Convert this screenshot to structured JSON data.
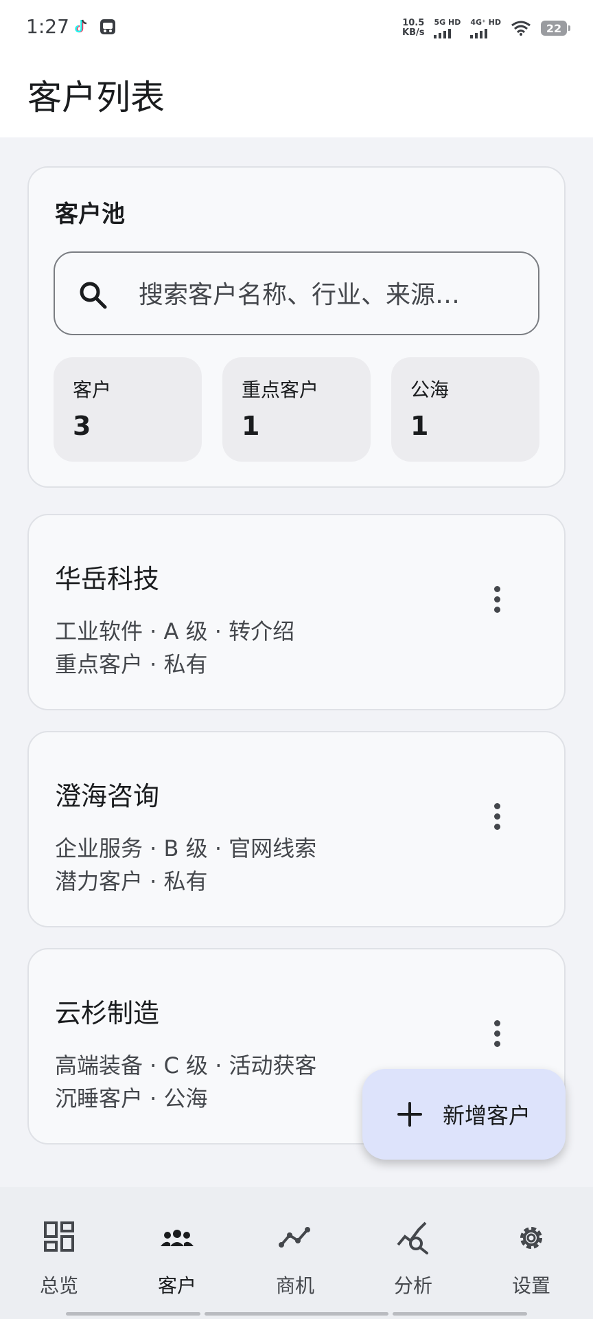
{
  "status_bar": {
    "time": "1:27",
    "net_speed": "10.5",
    "net_unit": "KB/s",
    "sim1": "5G HD",
    "sim2": "4G⁺ HD",
    "battery": "22",
    "icons": [
      "tiktok-icon",
      "app-notification-icon",
      "wifi-icon",
      "battery-icon"
    ]
  },
  "header": {
    "title": "客户列表"
  },
  "pool": {
    "title": "客户池",
    "search_placeholder": "搜索客户名称、行业、来源…",
    "stats": [
      {
        "label": "客户",
        "value": "3"
      },
      {
        "label": "重点客户",
        "value": "1"
      },
      {
        "label": "公海",
        "value": "1"
      }
    ]
  },
  "customers": [
    {
      "name": "华岳科技",
      "line1": "工业软件 · A 级 · 转介绍",
      "line2": "重点客户 · 私有"
    },
    {
      "name": "澄海咨询",
      "line1": "企业服务 · B 级 · 官网线索",
      "line2": "潜力客户 · 私有"
    },
    {
      "name": "云杉制造",
      "line1": "高端装备 · C 级 · 活动获客",
      "line2": "沉睡客户 · 公海"
    }
  ],
  "fab": {
    "label": "新增客户",
    "icon": "plus-icon"
  },
  "nav": {
    "active": "客户",
    "items": [
      {
        "label": "总览",
        "icon": "dashboard-icon"
      },
      {
        "label": "客户",
        "icon": "people-icon"
      },
      {
        "label": "商机",
        "icon": "trend-line-icon"
      },
      {
        "label": "分析",
        "icon": "analytics-search-icon"
      },
      {
        "label": "设置",
        "icon": "gear-icon"
      }
    ]
  },
  "colors": {
    "background": "#f2f3f7",
    "card": "#f8f9fb",
    "stat_tile": "#ececef",
    "fab": "#dde3fb",
    "nav_bar": "#eceef2"
  }
}
